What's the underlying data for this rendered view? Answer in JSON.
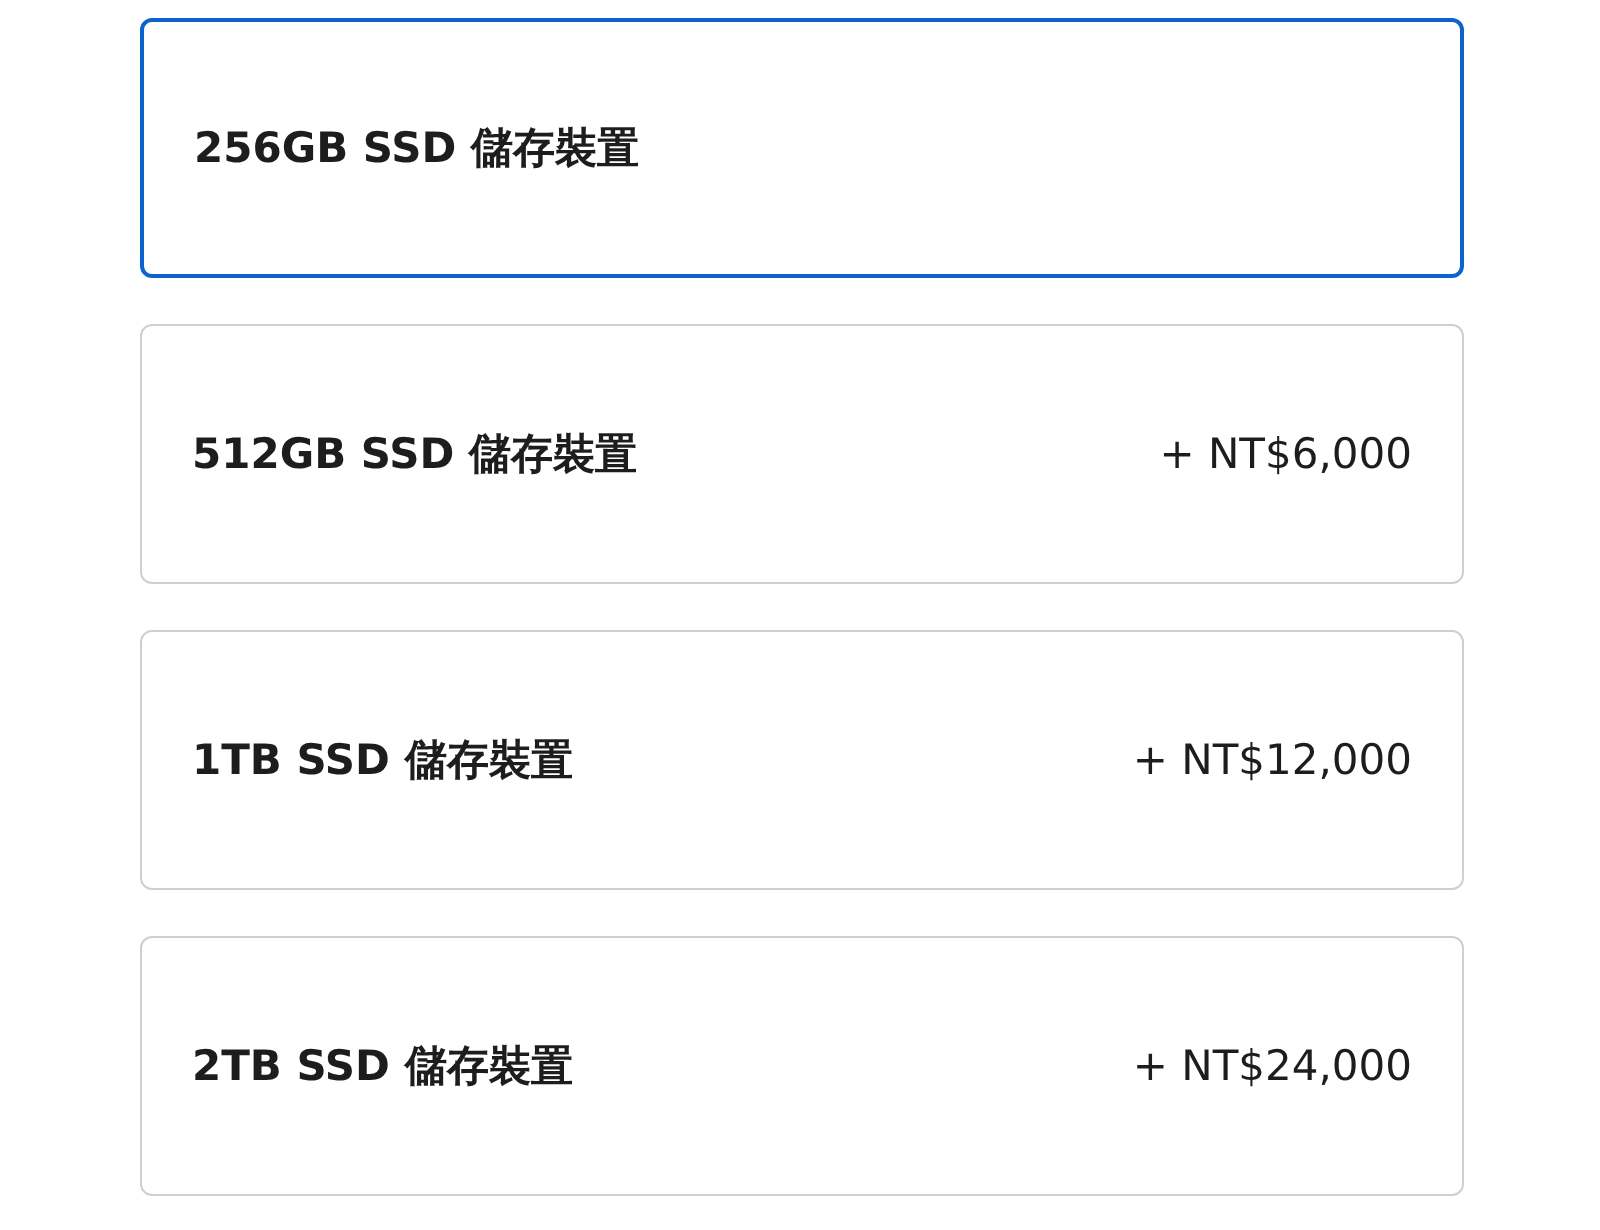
{
  "options": [
    {
      "name": "256GB SSD 儲存裝置",
      "selected": true
    },
    {
      "name": "512GB SSD 儲存裝置",
      "price": "+ NT$6,000",
      "selected": false
    },
    {
      "name": "1TB SSD 儲存裝置",
      "price": "+ NT$12,000",
      "selected": false
    },
    {
      "name": "2TB SSD 儲存裝置",
      "price": "+ NT$24,000",
      "selected": false
    }
  ]
}
